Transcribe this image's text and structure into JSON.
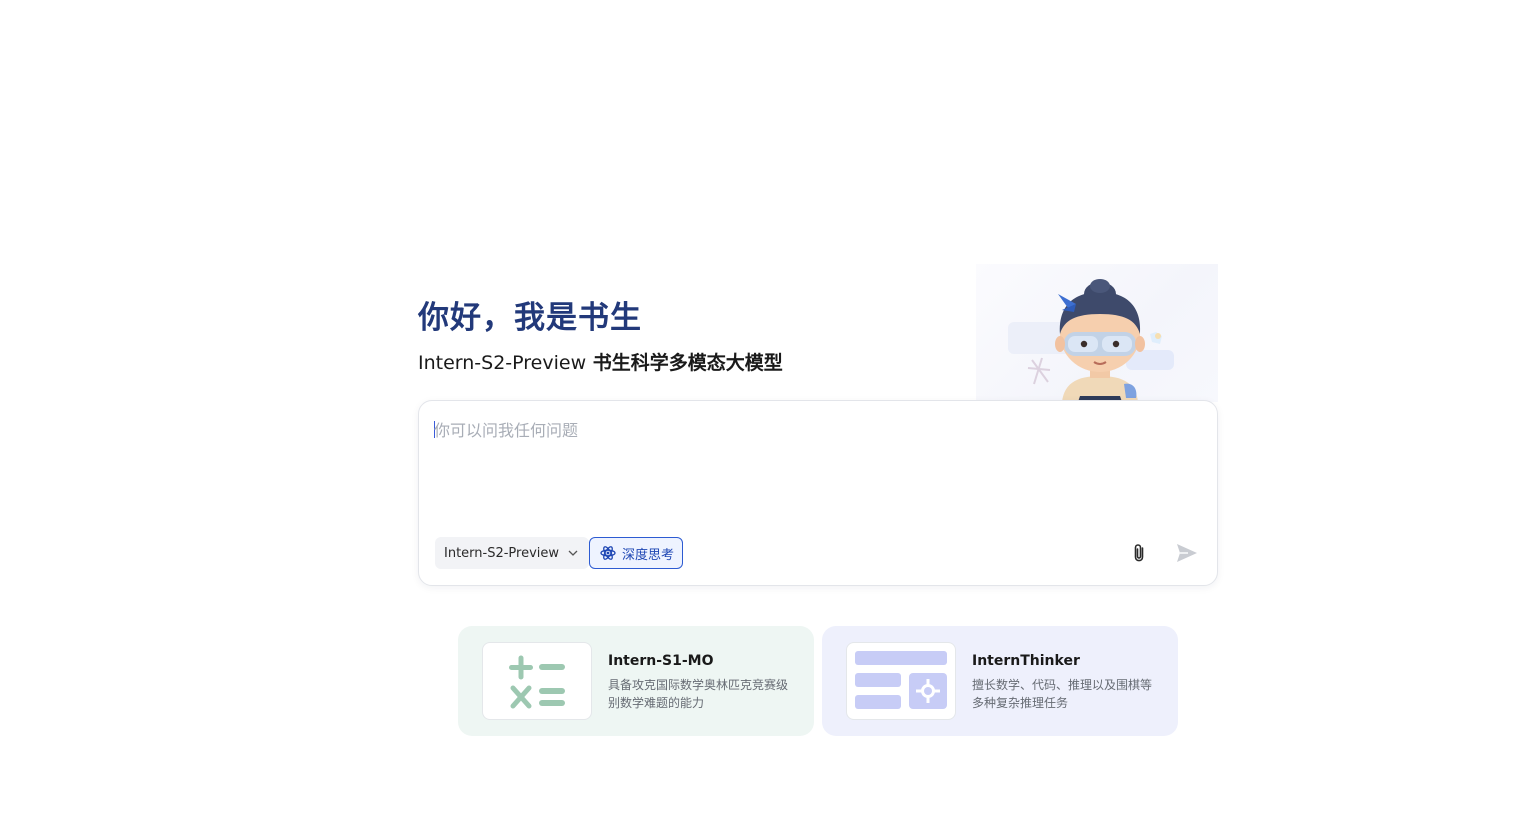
{
  "hero": {
    "greeting": "你好，我是书生",
    "subtitle_model": "Intern-S2-Preview",
    "subtitle_desc": "书生科学多模态大模型"
  },
  "input": {
    "placeholder": "你可以问我任何问题",
    "value": ""
  },
  "toolbar": {
    "model_select_value": "Intern-S2-Preview",
    "deep_think_label": "深度思考",
    "attach_icon": "paperclip-icon",
    "send_icon": "send-icon"
  },
  "cards": [
    {
      "title": "Intern-S1-MO",
      "description": "具备攻克国际数学奥林匹克竞赛级别数学难题的能力",
      "icon": "math-operators-icon"
    },
    {
      "title": "InternThinker",
      "description": "擅长数学、代码、推理以及围棋等多种复杂推理任务",
      "icon": "layout-grid-icon"
    }
  ],
  "colors": {
    "greeting": "#22397a",
    "accent": "#2d5bd2",
    "card_mo_bg": "#eef6f3",
    "card_thinker_bg": "#eef0fc"
  }
}
